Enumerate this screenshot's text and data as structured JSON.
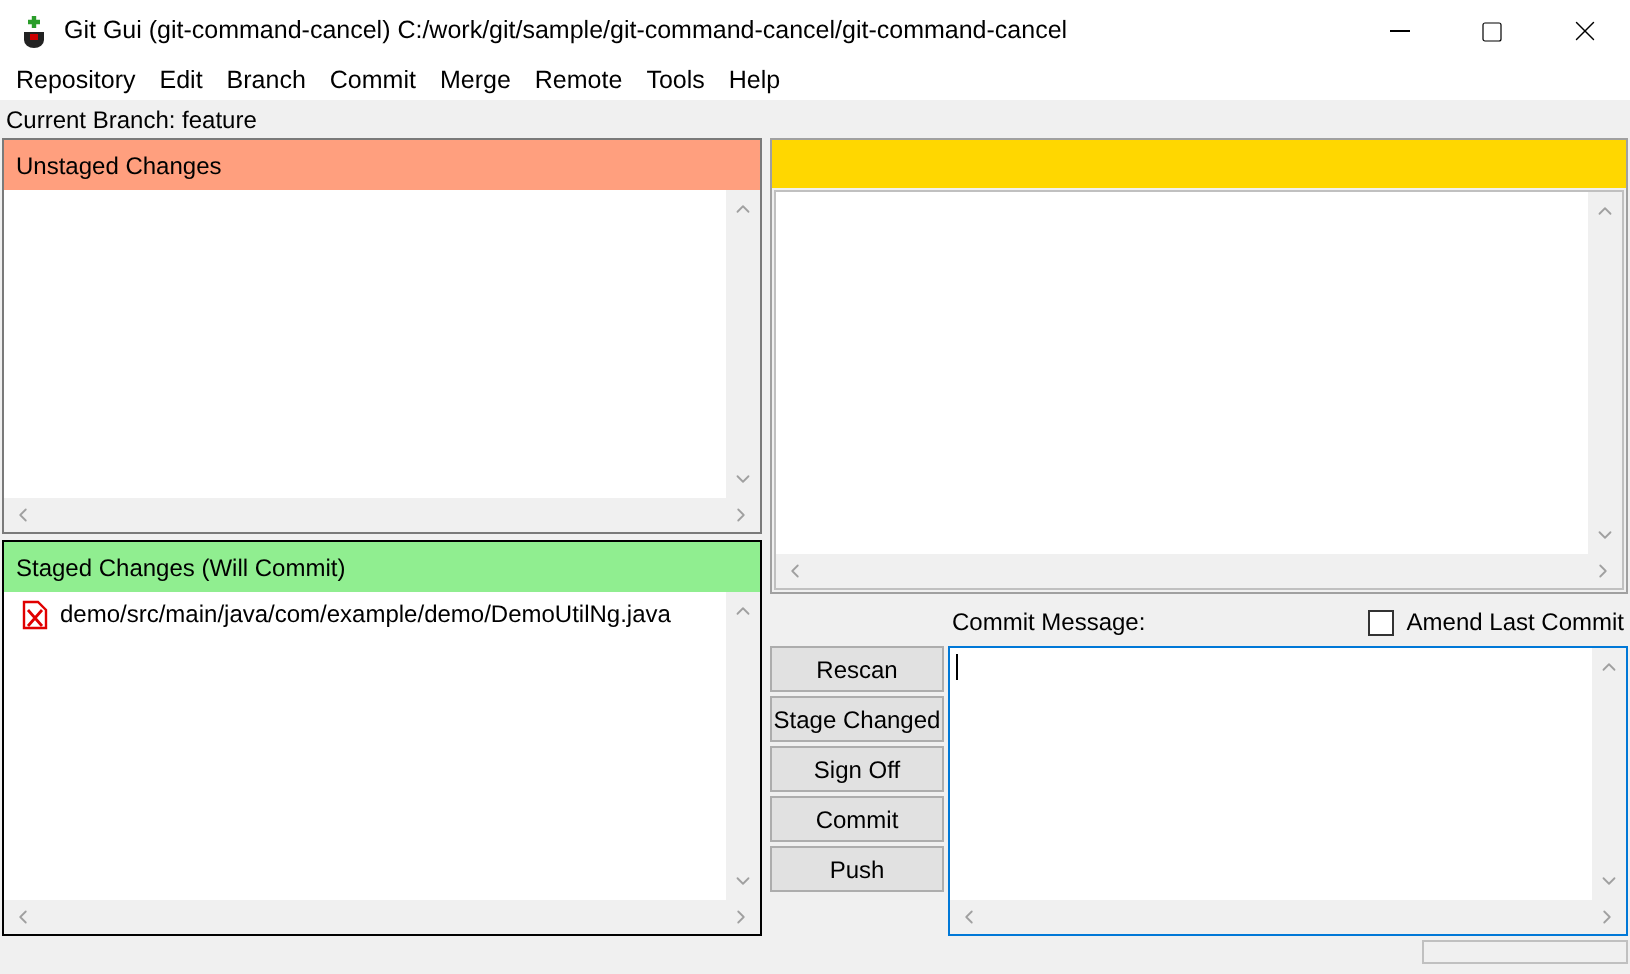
{
  "window": {
    "title": "Git Gui (git-command-cancel) C:/work/git/sample/git-command-cancel/git-command-cancel"
  },
  "menu": [
    "Repository",
    "Edit",
    "Branch",
    "Commit",
    "Merge",
    "Remote",
    "Tools",
    "Help"
  ],
  "current_branch": "Current Branch: feature",
  "unstaged": {
    "title": "Unstaged Changes"
  },
  "staged": {
    "title": "Staged Changes (Will Commit)",
    "files": [
      {
        "path": "demo/src/main/java/com/example/demo/DemoUtilNg.java"
      }
    ]
  },
  "commit": {
    "label": "Commit Message:",
    "amend": {
      "label": "Amend Last Commit",
      "checked": false
    }
  },
  "buttons": [
    "Rescan",
    "Stage Changed",
    "Sign Off",
    "Commit",
    "Push"
  ]
}
